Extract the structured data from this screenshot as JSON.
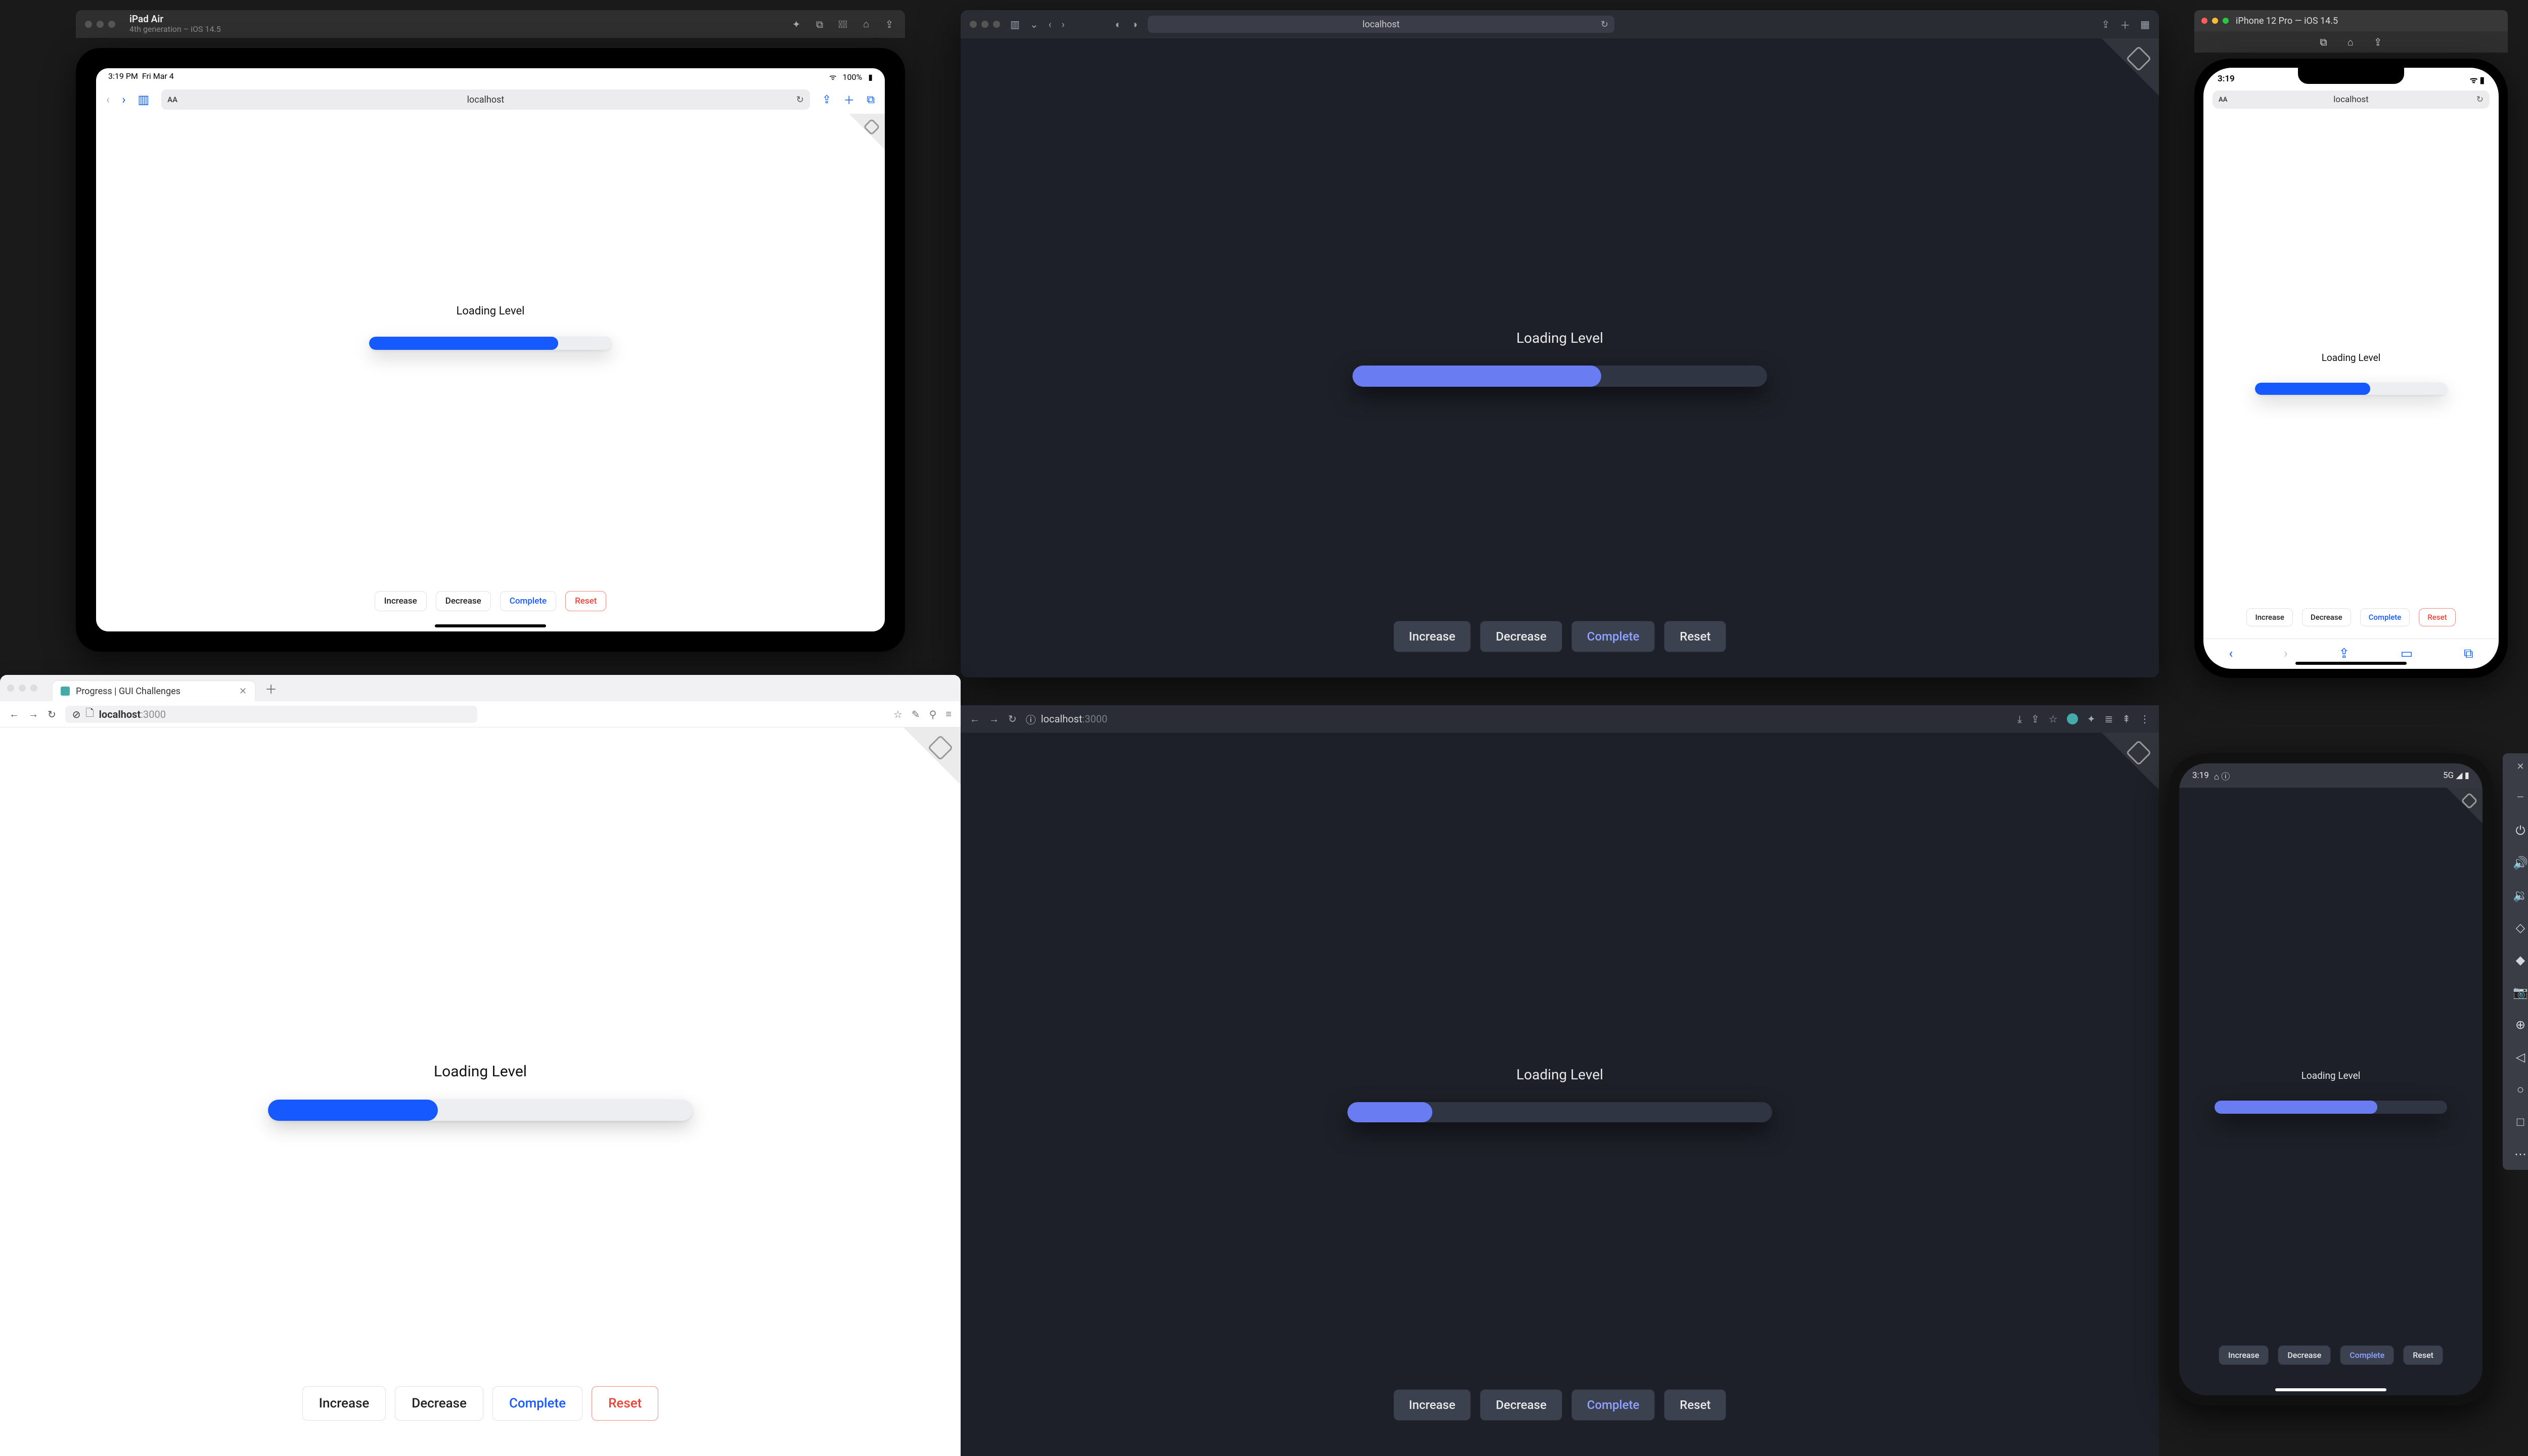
{
  "app": {
    "heading": "Loading Level",
    "buttons": {
      "increase": "Increase",
      "decrease": "Decrease",
      "complete": "Complete",
      "reset": "Reset"
    }
  },
  "progress": {
    "ipad_pct": 78,
    "safari_mac_pct": 60,
    "iphone_pct": 60,
    "firefox_pct": 40,
    "chrome_pct": 20,
    "android_pct": 70
  },
  "ipad_sim": {
    "title": "iPad Air",
    "subtitle": "4th generation – iOS 14.5",
    "status": {
      "time": "3:19 PM",
      "date": "Fri Mar 4",
      "battery": "100%"
    },
    "address": "localhost"
  },
  "safari_mac": {
    "address": "localhost"
  },
  "iphone_sim": {
    "title": "iPhone 12 Pro — iOS 14.5",
    "status_time": "3:19",
    "address": "localhost"
  },
  "firefox": {
    "tab_title": "Progress | GUI Challenges",
    "host": "localhost",
    "port": ":3000"
  },
  "chrome": {
    "host": "localhost",
    "port": ":3000"
  },
  "android": {
    "status_time": "3:19",
    "status_icons": "5G ◢ ▮"
  }
}
